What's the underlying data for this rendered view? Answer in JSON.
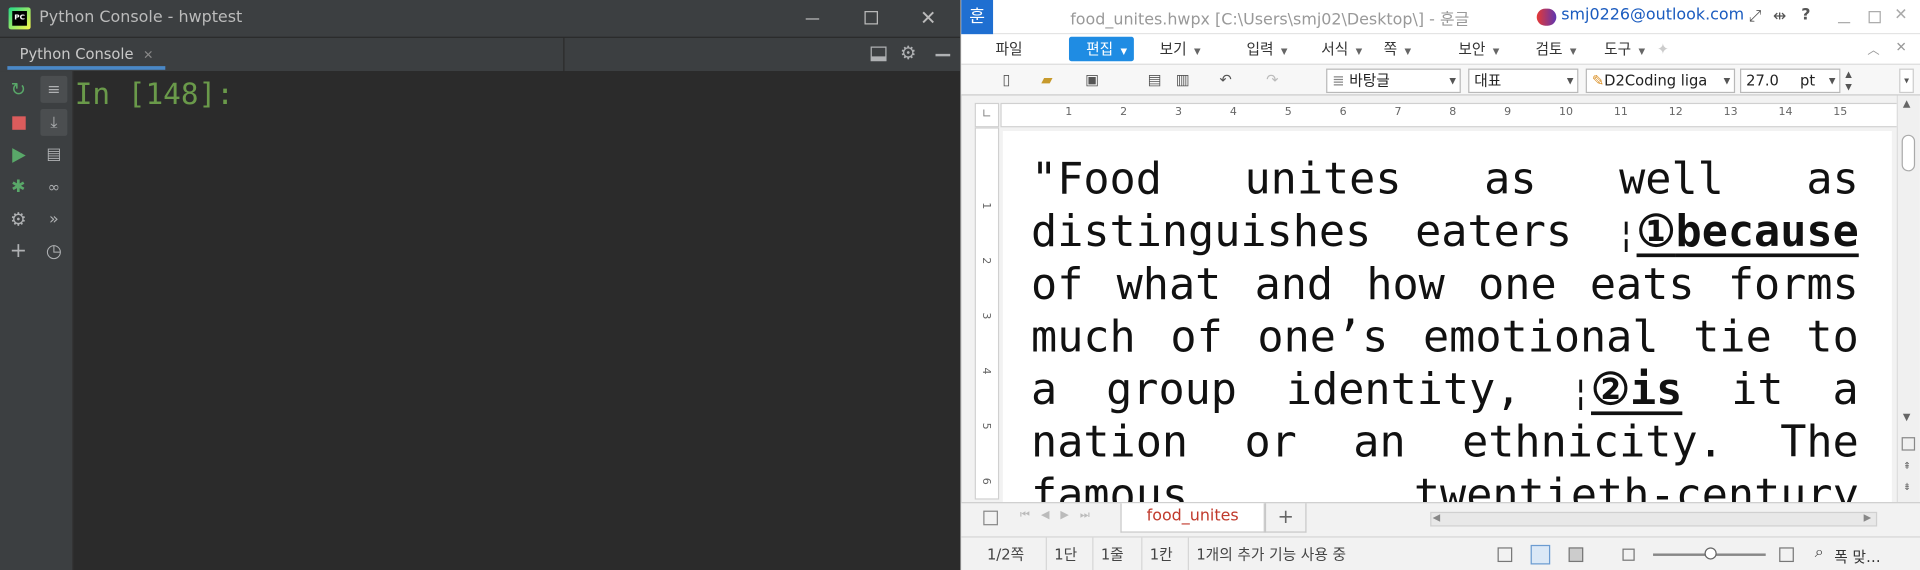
{
  "console": {
    "window_title": "Python Console - hwptest",
    "app_badge": "PC",
    "tab_label": "Python Console",
    "tab_close": "✕",
    "prompt": "In [148]:",
    "colors": {
      "bg": "#2b2b2b",
      "prompt": "#6a9a4a",
      "accent": "#4a88c7"
    }
  },
  "hwp": {
    "app_icon": "훈",
    "window_title": "food_unites.hwpx [C:\\Users\\smj02\\Desktop\\] - 훈글",
    "account_email": "smj0226@outlook.com",
    "menu": [
      {
        "label": "파일"
      },
      {
        "label": "편집",
        "active": true
      },
      {
        "label": "보기"
      },
      {
        "label": "입력"
      },
      {
        "label": "서식"
      },
      {
        "label": "쪽"
      },
      {
        "label": "보안"
      },
      {
        "label": "검토"
      },
      {
        "label": "도구"
      }
    ],
    "toolbar": {
      "paragraph_style": "바탕글",
      "font_lang": "대표",
      "font_name": "D2Coding liga",
      "font_size": "27.0",
      "font_unit": "pt"
    },
    "ruler_marks": [
      "1",
      "2",
      "3",
      "4",
      "5",
      "6",
      "7",
      "8",
      "9",
      "10",
      "11",
      "12",
      "13",
      "14",
      "15"
    ],
    "vruler_marks": [
      "1",
      "2",
      "3",
      "4",
      "5",
      "6"
    ],
    "document": {
      "lines": [
        {
          "words": [
            "\"Food",
            "unites",
            "as",
            "well",
            "as"
          ]
        },
        {
          "words": [
            "distinguishes",
            "eaters"
          ],
          "marker": "¦",
          "tail_circ": "①",
          "tail_word": "because"
        },
        {
          "words": [
            "of",
            "what",
            "and",
            "how",
            "one",
            "eats",
            "forms"
          ]
        },
        {
          "words": [
            "much",
            "of",
            "one’s",
            "emotional",
            "tie",
            "to"
          ]
        },
        {
          "words": [
            "a",
            "group",
            "identity,"
          ],
          "marker": "¦",
          "mid_circ": "②",
          "mid_word": "is",
          "rest": [
            "it",
            "a"
          ]
        },
        {
          "words": [
            "nation",
            "or",
            "an",
            "ethnicity.",
            "The"
          ]
        },
        {
          "words": [
            "famous",
            "twentieth-century"
          ]
        }
      ]
    },
    "doc_tab": "food_unites",
    "add_tab": "+",
    "status": {
      "page": "1/2쪽",
      "column": "1단",
      "line": "1줄",
      "char": "1칸",
      "extra": "1개의 추가 기능 사용 중",
      "zoom_label": "폭 맞…"
    },
    "colors": {
      "menu_active": "#1f8ce3",
      "doc_tab_text": "#c0392b",
      "email": "#1a5bbf"
    }
  }
}
